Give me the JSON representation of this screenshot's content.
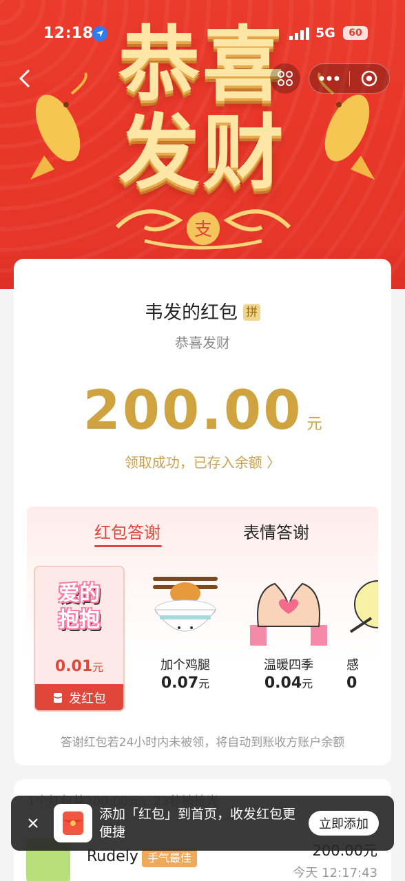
{
  "status_bar": {
    "time": "12:18",
    "network": "5G",
    "battery": "60"
  },
  "hero": {
    "headline_line1": "恭喜",
    "headline_line2": "发财",
    "emblem_char": "支"
  },
  "card": {
    "sender": "韦发的红包",
    "sender_badge": "拼",
    "greeting": "恭喜发财",
    "amount": "200.00",
    "amount_unit": "元",
    "receipt_link": "领取成功，已存入余额 〉"
  },
  "thanks": {
    "tabs": [
      "红包答谢",
      "表情答谢"
    ],
    "gifts": [
      {
        "art_line1": "爱的",
        "art_line2": "抱抱",
        "price": "0.01",
        "unit": "元",
        "send_label": "发红包"
      },
      {
        "name": "加个鸡腿",
        "price": "0.07",
        "unit": "元"
      },
      {
        "name": "温暖四季",
        "price": "0.04",
        "unit": "元"
      },
      {
        "name": "感",
        "price": "0",
        "unit": ""
      }
    ],
    "note": "答谢红包若24小时内未被领，将自动到账收方账户余额"
  },
  "records": {
    "summary": "1个红包共200.00元，23秒被抢光",
    "user": "Rudely",
    "best_badge": "手气最佳",
    "amount": "200.00元",
    "time": "今天 12:17:43"
  },
  "toast": {
    "message": "添加「红包」到首页，收发红包更便捷",
    "button": "立即添加"
  },
  "colors": {
    "accent": "#e0463a",
    "gold": "#cfa440",
    "hero_red": "#e83628"
  }
}
